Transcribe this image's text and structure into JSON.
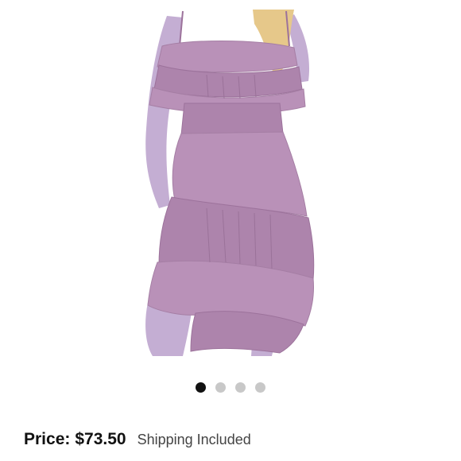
{
  "product": {
    "image_alt": "Lavender ruffled tiered high-low dress",
    "dress_color": "#b991b8",
    "skin_color": "#c4aed3",
    "hair_color": "#e6c88a"
  },
  "carousel": {
    "count": 4,
    "active_index": 0
  },
  "pricing": {
    "label": "Price:",
    "amount": "$73.50",
    "shipping": "Shipping Included"
  }
}
